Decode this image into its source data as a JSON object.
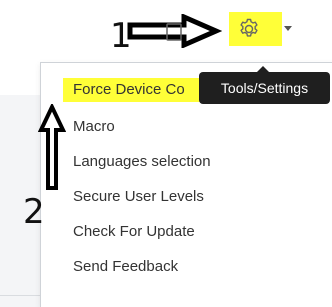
{
  "annotations": {
    "step_1": "1",
    "step_2": "2"
  },
  "toolbar": {
    "settings_icon": "gear-icon",
    "highlight_color": "#ffff38",
    "tooltip": "Tools/Settings"
  },
  "menu": {
    "items": [
      {
        "label": "Force Device Co",
        "highlighted": true
      },
      {
        "label": "Macro"
      },
      {
        "label": "Languages selection"
      },
      {
        "label": "Secure User Levels"
      },
      {
        "label": "Check For Update"
      },
      {
        "label": "Send Feedback"
      }
    ]
  }
}
